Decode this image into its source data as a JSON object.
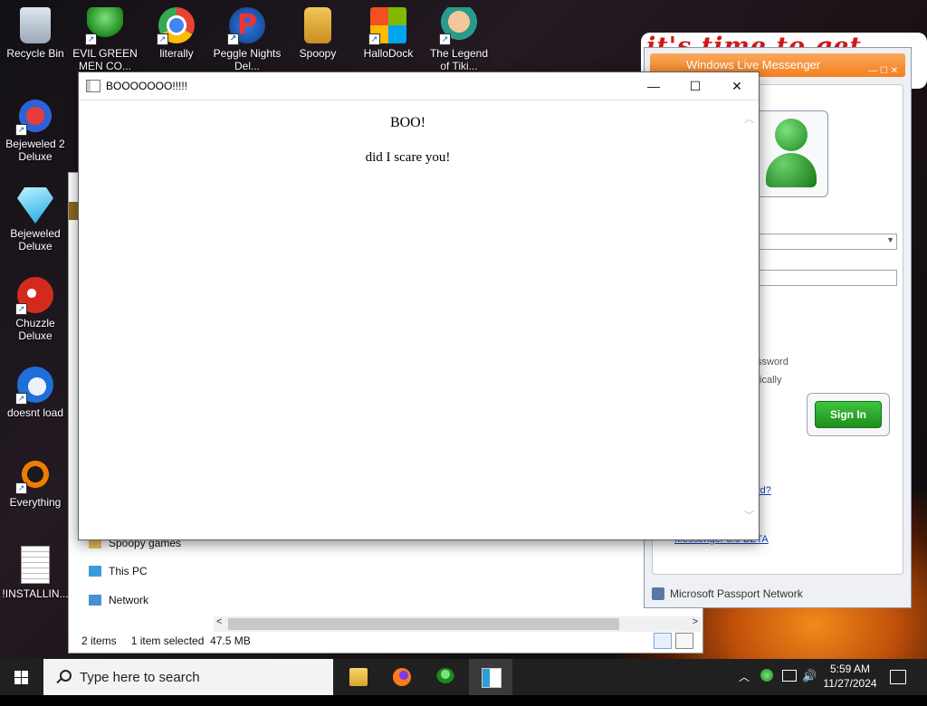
{
  "desktop": {
    "slogan": "it's time to get shit",
    "icons": [
      {
        "label": "Recycle Bin"
      },
      {
        "label": "EVIL GREEN MEN CO..."
      },
      {
        "label": "literally"
      },
      {
        "label": "Peggle Nights Del..."
      },
      {
        "label": "Spoopy"
      },
      {
        "label": "HalloDock"
      },
      {
        "label": "The Legend of Tiki..."
      },
      {
        "label": "Bejeweled 2 Deluxe"
      },
      {
        "label": "Bejeweled Deluxe"
      },
      {
        "label": "Chuzzle Deluxe"
      },
      {
        "label": "doesnt load"
      },
      {
        "label": "Everything"
      },
      {
        "label": "!INSTALLIN..."
      }
    ]
  },
  "explorer": {
    "nav": [
      "Spoopy games",
      "This PC",
      "Network"
    ],
    "status": {
      "items": "2 items",
      "selected": "1 item selected",
      "size": "47.5 MB"
    }
  },
  "messenger": {
    "title": "Windows Live Messenger",
    "remember_password": "ssword",
    "sign_in_auto": "tically",
    "sign_in_button": "Sign In",
    "forgot_link": "rd?",
    "beta_link": "Messenger 8.0 BETA",
    "footer": "Microsoft Passport Network"
  },
  "window": {
    "title": "BOOOOOOO!!!!!",
    "heading": "BOO!",
    "text": "did I scare you!",
    "minimize": "—",
    "maximize": "☐",
    "close": "✕"
  },
  "taskbar": {
    "search_placeholder": "Type here to search",
    "time": "5:59 AM",
    "date": "11/27/2024"
  }
}
